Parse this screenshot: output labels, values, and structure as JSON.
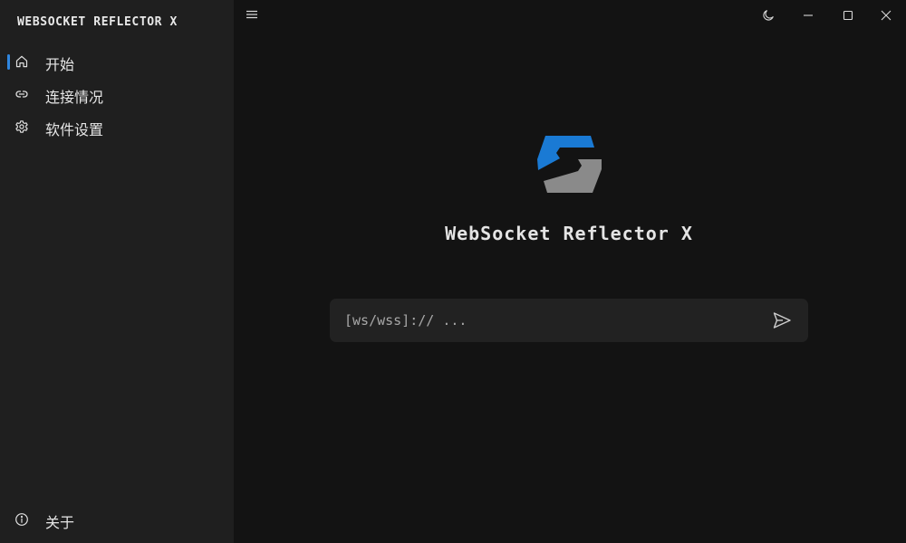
{
  "sidebar": {
    "app_title": "WEBSOCKET REFLECTOR X",
    "items": [
      {
        "label": "开始",
        "icon": "home-icon",
        "active": true
      },
      {
        "label": "连接情况",
        "icon": "link-icon",
        "active": false
      },
      {
        "label": "软件设置",
        "icon": "gear-icon",
        "active": false
      }
    ],
    "footer_item": {
      "label": "关于",
      "icon": "info-icon"
    }
  },
  "topbar": {
    "menu_icon": "hamburger-menu-icon",
    "window_controls": [
      "theme-toggle-icon",
      "minimize-icon",
      "maximize-icon",
      "close-icon"
    ]
  },
  "main": {
    "title": "WebSocket Reflector X",
    "url_input": {
      "value": "",
      "placeholder": "[ws/wss]:// ..."
    },
    "send_icon": "send-icon"
  },
  "colors": {
    "accent": "#2f86e0",
    "logo_blue": "#1a7ad4",
    "logo_gray": "#8a8a8a",
    "sidebar_bg": "#1f1f1f",
    "main_bg": "#131313",
    "input_bg": "#222222"
  }
}
